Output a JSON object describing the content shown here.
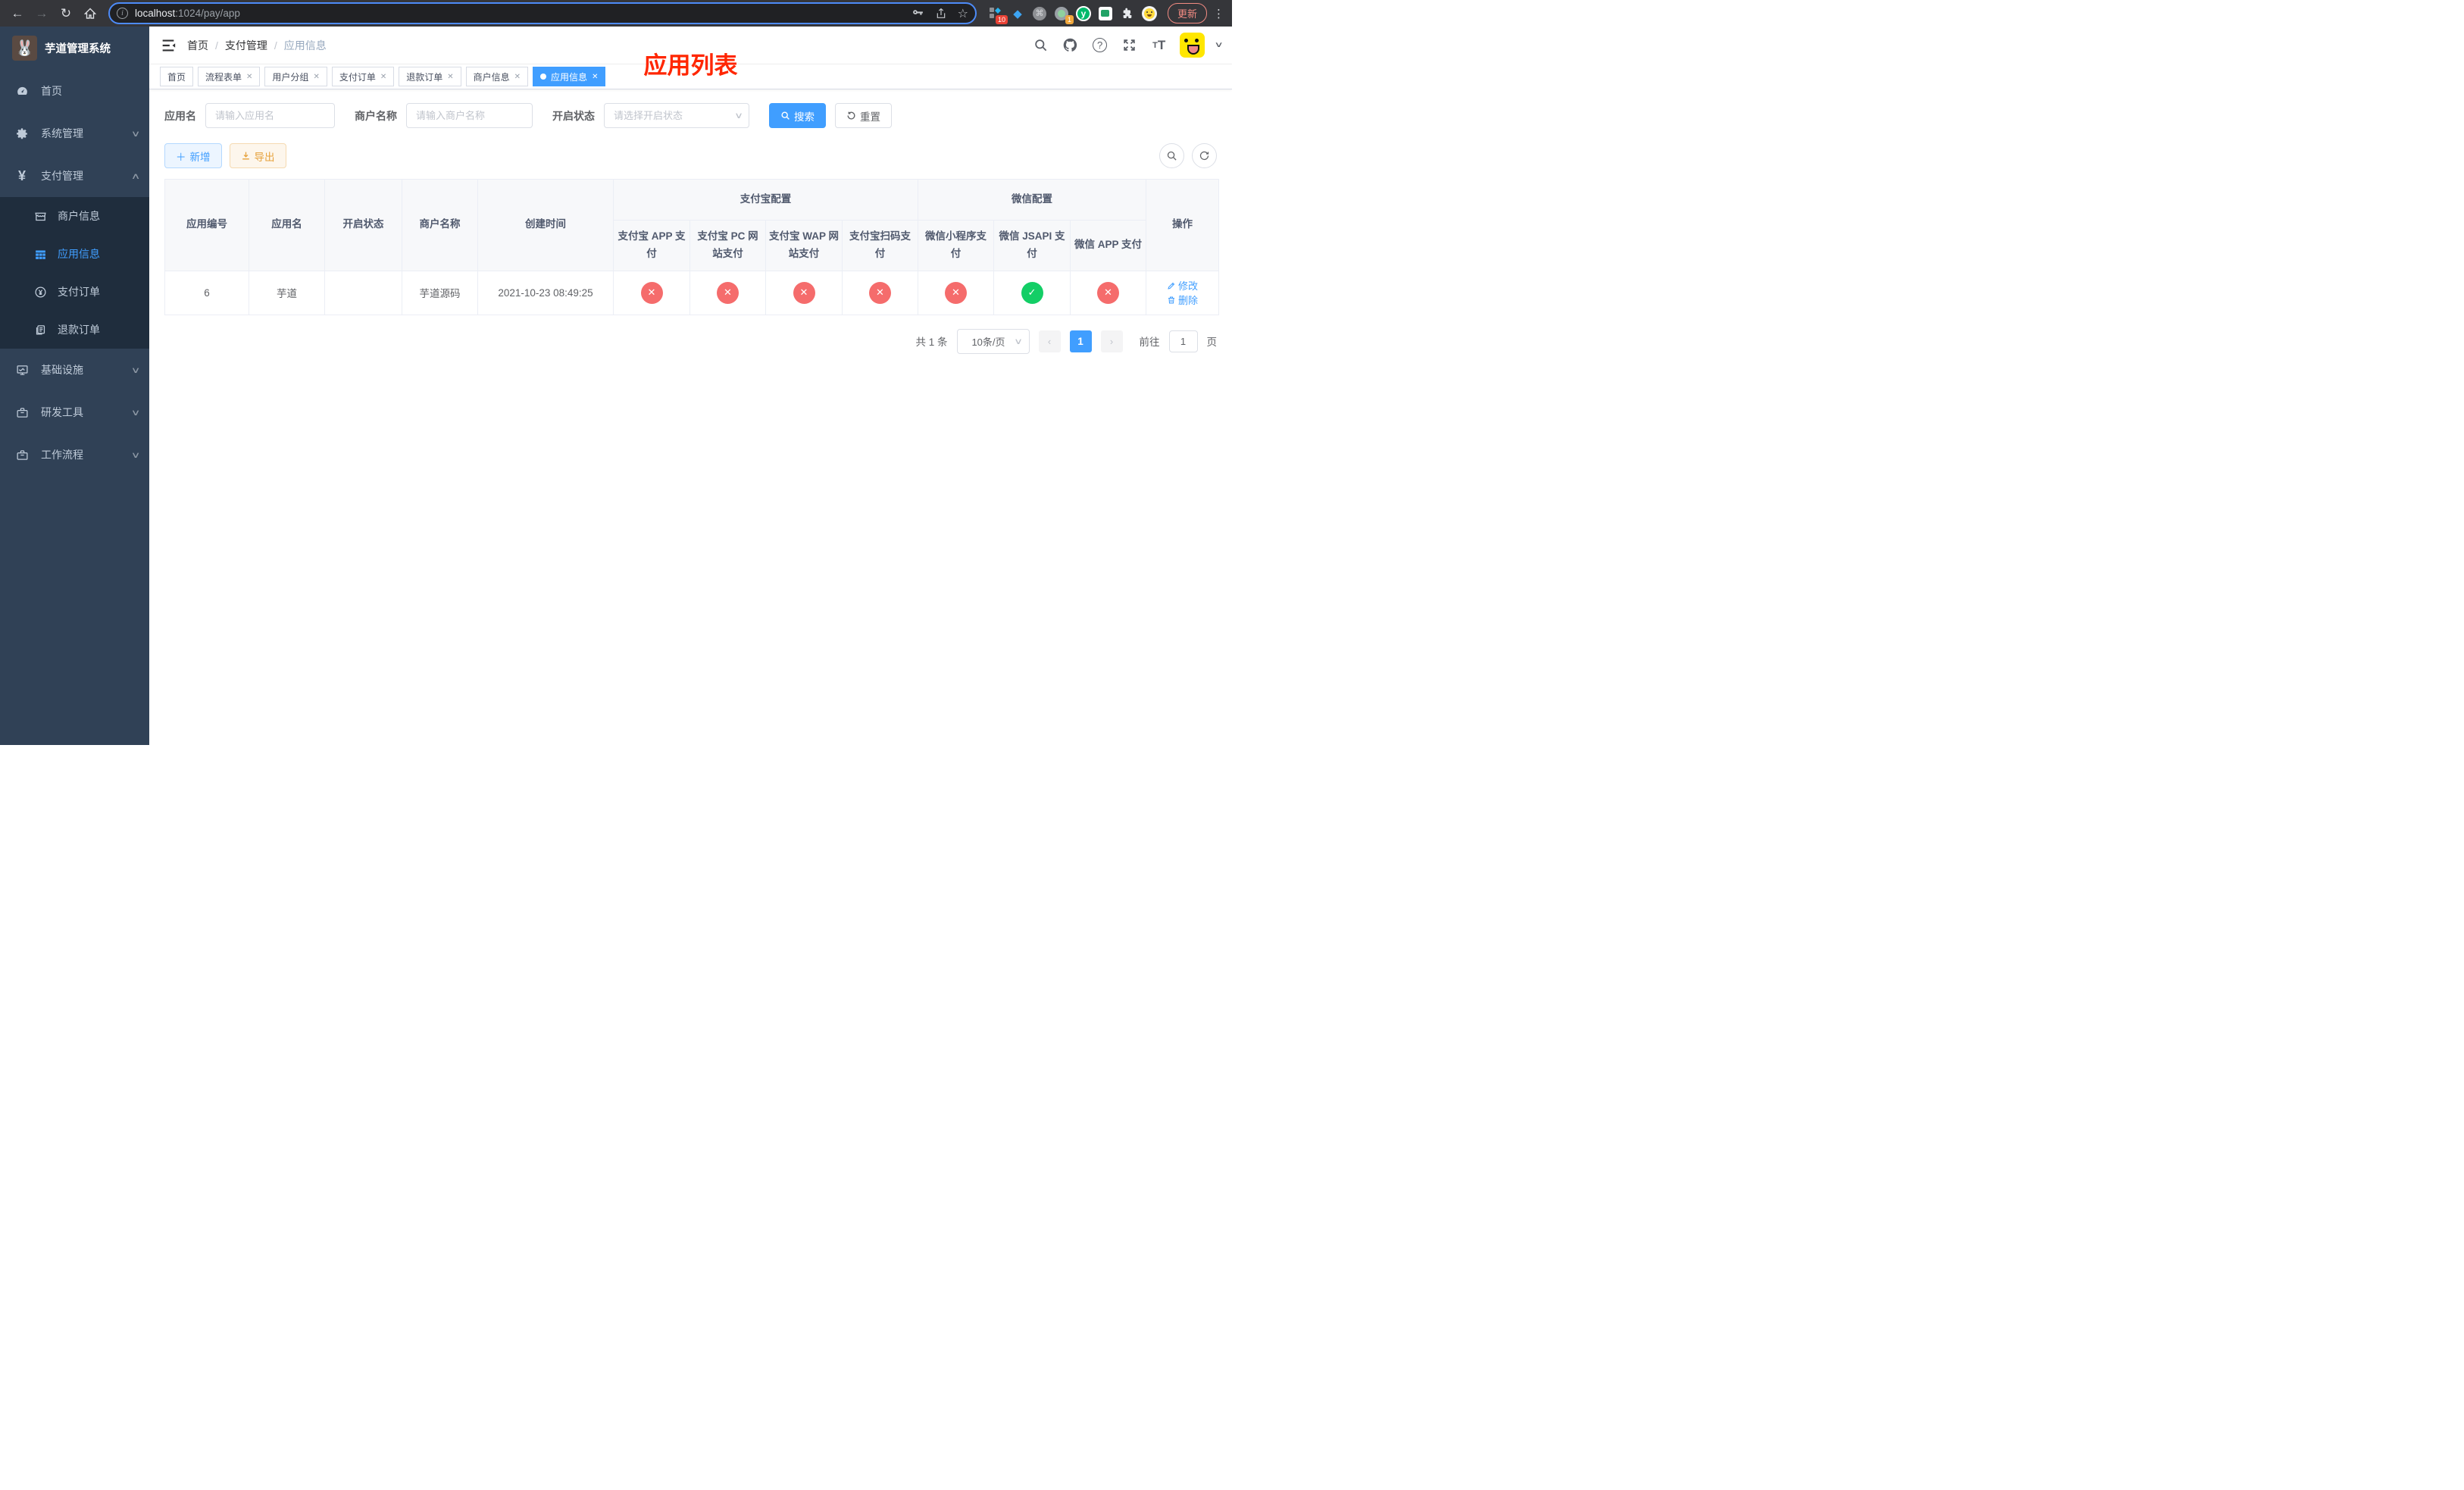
{
  "browser": {
    "url_host": "localhost",
    "url_rest": ":1024/pay/app",
    "ext_badge_grid": "10",
    "ext_badge_avatar": "1",
    "yuque_letter": "y",
    "update_label": "更新"
  },
  "sidebar": {
    "title": "芋道管理系统",
    "items": [
      {
        "label": "首页"
      },
      {
        "label": "系统管理"
      },
      {
        "label": "支付管理"
      },
      {
        "label": "基础设施"
      },
      {
        "label": "研发工具"
      },
      {
        "label": "工作流程"
      }
    ],
    "submenu": [
      {
        "label": "商户信息",
        "active": false
      },
      {
        "label": "应用信息",
        "active": true
      },
      {
        "label": "支付订单",
        "active": false
      },
      {
        "label": "退款订单",
        "active": false
      }
    ]
  },
  "header": {
    "breadcrumb": [
      "首页",
      "支付管理",
      "应用信息"
    ],
    "annotation": "应用列表"
  },
  "tabs": [
    {
      "label": "首页"
    },
    {
      "label": "流程表单"
    },
    {
      "label": "用户分组"
    },
    {
      "label": "支付订单"
    },
    {
      "label": "退款订单"
    },
    {
      "label": "商户信息"
    },
    {
      "label": "应用信息"
    }
  ],
  "filters": {
    "app_name_label": "应用名",
    "app_name_placeholder": "请输入应用名",
    "merchant_label": "商户名称",
    "merchant_placeholder": "请输入商户名称",
    "status_label": "开启状态",
    "status_placeholder": "请选择开启状态",
    "search_label": "搜索",
    "reset_label": "重置"
  },
  "toolbar": {
    "add_label": "新增",
    "export_label": "导出"
  },
  "table": {
    "columns": {
      "app_id": "应用编号",
      "app_name": "应用名",
      "status": "开启状态",
      "merchant": "商户名称",
      "created": "创建时间",
      "alipay_group": "支付宝配置",
      "wechat_group": "微信配置",
      "alipay_app": "支付宝 APP 支付",
      "alipay_pc": "支付宝 PC 网站支付",
      "alipay_wap": "支付宝 WAP 网站支付",
      "alipay_qr": "支付宝扫码支付",
      "wx_mini": "微信小程序支付",
      "wx_jsapi": "微信 JSAPI 支付",
      "wx_app": "微信 APP 支付",
      "ops": "操作"
    },
    "rows": [
      {
        "id": "6",
        "name": "芋道",
        "enabled": true,
        "merchant": "芋道源码",
        "created": "2021-10-23 08:49:25",
        "statuses": [
          "fail",
          "fail",
          "fail",
          "fail",
          "fail",
          "success",
          "fail"
        ],
        "edit_label": "修改",
        "delete_label": "删除"
      }
    ]
  },
  "pagination": {
    "total": "共 1 条",
    "page_size": "10条/页",
    "prev": "‹",
    "current_page": "1",
    "next": "›",
    "goto_label": "前往",
    "goto_value": "1",
    "page_unit": "页"
  }
}
